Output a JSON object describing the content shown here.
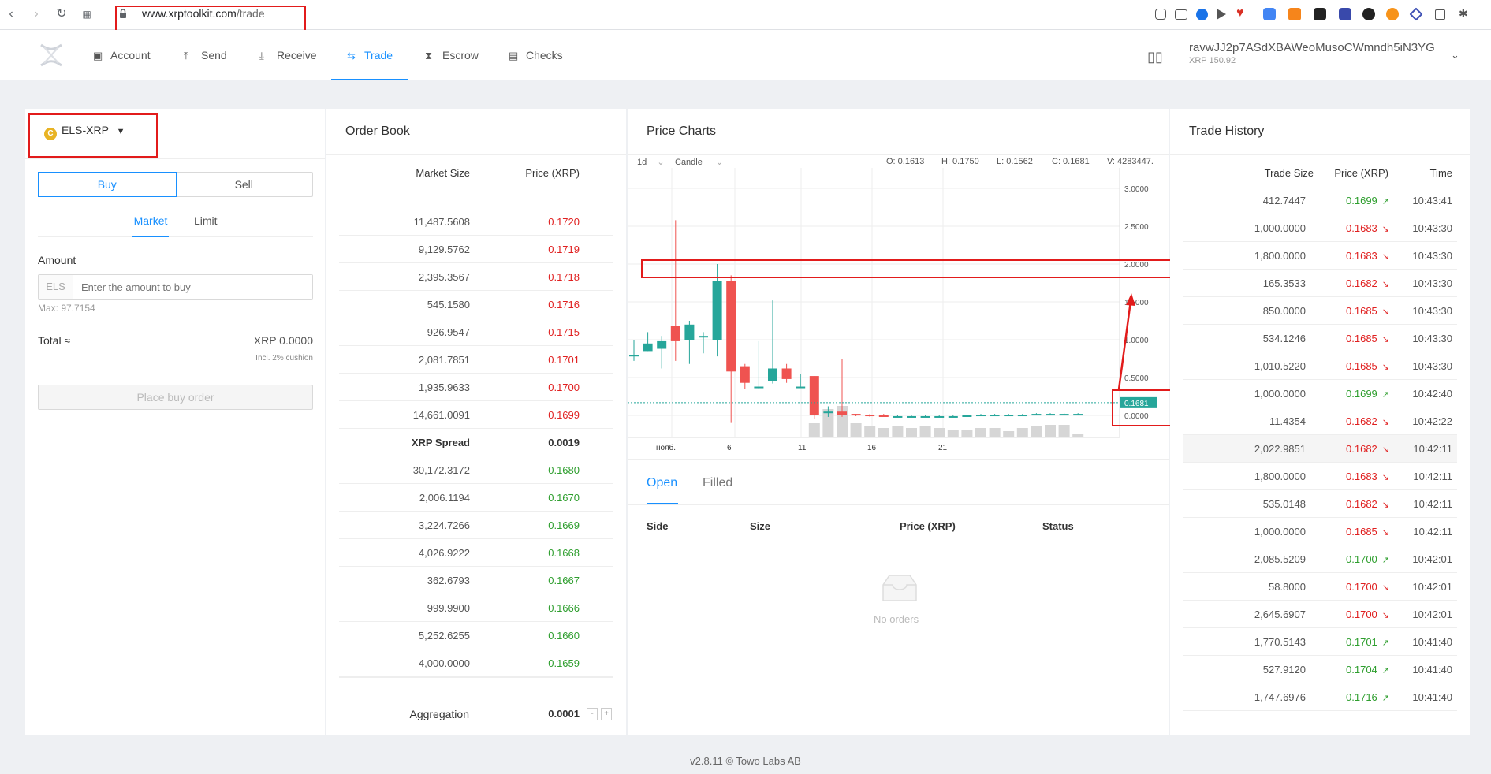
{
  "browser": {
    "url_host": "www.xrptoolkit.com",
    "url_path": "/trade"
  },
  "nav": {
    "items": [
      {
        "label": "Account",
        "icon": "wallet-icon"
      },
      {
        "label": "Send",
        "icon": "upload-icon"
      },
      {
        "label": "Receive",
        "icon": "download-icon"
      },
      {
        "label": "Trade",
        "icon": "swap-icon",
        "active": true
      },
      {
        "label": "Escrow",
        "icon": "hourglass-icon"
      },
      {
        "label": "Checks",
        "icon": "check-doc-icon"
      }
    ],
    "account_address": "ravwJJ2p7ASdXBAWeoMusoCWmndh5iN3YG",
    "account_balance": "XRP 150.92"
  },
  "trade": {
    "pair": "ELS-XRP",
    "pair_coin_glyph": "C",
    "buy_label": "Buy",
    "sell_label": "Sell",
    "market_label": "Market",
    "limit_label": "Limit",
    "amount_label": "Amount",
    "amount_unit": "ELS",
    "amount_placeholder": "Enter the amount to buy",
    "max_label": "Max: 97.7154",
    "total_label": "Total ≈",
    "total_value": "XRP 0.0000",
    "cushion_note": "Incl. 2% cushion",
    "place_order_label": "Place buy order"
  },
  "order_book": {
    "title": "Order Book",
    "col_size": "Market Size",
    "col_price": "Price (XRP)",
    "asks": [
      {
        "size": "11,487.5608",
        "price": "0.1720"
      },
      {
        "size": "9,129.5762",
        "price": "0.1719"
      },
      {
        "size": "2,395.3567",
        "price": "0.1718"
      },
      {
        "size": "545.1580",
        "price": "0.1716"
      },
      {
        "size": "926.9547",
        "price": "0.1715"
      },
      {
        "size": "2,081.7851",
        "price": "0.1701"
      },
      {
        "size": "1,935.9633",
        "price": "0.1700"
      },
      {
        "size": "14,661.0091",
        "price": "0.1699"
      }
    ],
    "spread_label": "XRP Spread",
    "spread_value": "0.0019",
    "bids": [
      {
        "size": "30,172.3172",
        "price": "0.1680"
      },
      {
        "size": "2,006.1194",
        "price": "0.1670"
      },
      {
        "size": "3,224.7266",
        "price": "0.1669"
      },
      {
        "size": "4,026.9222",
        "price": "0.1668"
      },
      {
        "size": "362.6793",
        "price": "0.1667"
      },
      {
        "size": "999.9900",
        "price": "0.1666"
      },
      {
        "size": "5,252.6255",
        "price": "0.1660"
      },
      {
        "size": "4,000.0000",
        "price": "0.1659"
      }
    ],
    "aggregation_label": "Aggregation",
    "aggregation_value": "0.0001"
  },
  "price_chart": {
    "title": "Price Charts",
    "interval": "1d",
    "style": "Candle",
    "ohlc": "O: 0.1613",
    "high": "H: 0.1750",
    "low": "L: 0.1562",
    "close": "C: 0.1681",
    "volume": "V: 4283447.",
    "current_price": "0.1681",
    "y_ticks": [
      "3.0000",
      "2.5000",
      "2.0000",
      "1.5000",
      "1.0000",
      "0.5000",
      "0.0000"
    ],
    "x_ticks": [
      "нояб.",
      "6",
      "11",
      "16",
      "21"
    ]
  },
  "chart_data": {
    "type": "bar",
    "title": "Price Charts",
    "ylim": [
      0,
      3.0
    ],
    "y_ticks": [
      3.0,
      2.5,
      2.0,
      1.5,
      1.0,
      0.5,
      0.0
    ],
    "x_ticks": [
      "нояб.",
      "6",
      "11",
      "16",
      "21"
    ],
    "candles": [
      {
        "o": 0.78,
        "h": 1.0,
        "l": 0.72,
        "c": 0.8
      },
      {
        "o": 0.85,
        "h": 1.1,
        "l": 0.85,
        "c": 0.95
      },
      {
        "o": 0.88,
        "h": 1.05,
        "l": 0.62,
        "c": 0.98
      },
      {
        "o": 1.18,
        "h": 2.58,
        "l": 0.72,
        "c": 0.98
      },
      {
        "o": 1.0,
        "h": 1.25,
        "l": 0.68,
        "c": 1.2
      },
      {
        "o": 1.05,
        "h": 1.1,
        "l": 0.82,
        "c": 1.05
      },
      {
        "o": 1.0,
        "h": 2.0,
        "l": 0.78,
        "c": 1.78
      },
      {
        "o": 1.78,
        "h": 1.85,
        "l": -0.1,
        "c": 0.58
      },
      {
        "o": 0.65,
        "h": 0.68,
        "l": 0.35,
        "c": 0.43
      },
      {
        "o": 0.38,
        "h": 0.98,
        "l": 0.35,
        "c": 0.38
      },
      {
        "o": 0.45,
        "h": 1.52,
        "l": 0.42,
        "c": 0.62
      },
      {
        "o": 0.62,
        "h": 0.68,
        "l": 0.43,
        "c": 0.48
      },
      {
        "o": 0.38,
        "h": 0.55,
        "l": 0.38,
        "c": 0.38
      },
      {
        "o": 0.52,
        "h": 0.52,
        "l": -0.05,
        "c": 0.01
      },
      {
        "o": 0.05,
        "h": 0.12,
        "l": -0.02,
        "c": 0.05
      },
      {
        "o": 0.05,
        "h": 0.75,
        "l": -0.02,
        "c": 0.0
      },
      {
        "o": 0.02,
        "h": 0.02,
        "l": -0.01,
        "c": 0.0
      },
      {
        "o": 0.01,
        "h": 0.02,
        "l": -0.02,
        "c": 0.0
      },
      {
        "o": 0.0,
        "h": 0.02,
        "l": -0.01,
        "c": -0.01
      },
      {
        "o": -0.01,
        "h": 0.01,
        "l": -0.02,
        "c": -0.01
      },
      {
        "o": -0.01,
        "h": 0.01,
        "l": -0.02,
        "c": -0.01
      },
      {
        "o": -0.01,
        "h": 0.01,
        "l": -0.02,
        "c": -0.01
      },
      {
        "o": -0.01,
        "h": 0.01,
        "l": -0.02,
        "c": -0.01
      },
      {
        "o": -0.01,
        "h": 0.01,
        "l": -0.02,
        "c": -0.01
      },
      {
        "o": -0.01,
        "h": 0.01,
        "l": -0.02,
        "c": 0.0
      },
      {
        "o": 0.0,
        "h": 0.02,
        "l": -0.01,
        "c": 0.01
      },
      {
        "o": 0.0,
        "h": 0.02,
        "l": -0.01,
        "c": 0.01
      },
      {
        "o": 0.0,
        "h": 0.02,
        "l": -0.01,
        "c": 0.01
      },
      {
        "o": 0.0,
        "h": 0.02,
        "l": -0.01,
        "c": 0.01
      },
      {
        "o": 0.01,
        "h": 0.03,
        "l": 0.0,
        "c": 0.02
      },
      {
        "o": 0.01,
        "h": 0.03,
        "l": 0.0,
        "c": 0.02
      },
      {
        "o": 0.01,
        "h": 0.03,
        "l": 0.0,
        "c": 0.02
      },
      {
        "o": 0.01,
        "h": 0.03,
        "l": 0.0,
        "c": 0.02
      }
    ],
    "volume_bars": [
      0,
      0,
      0,
      0,
      0,
      0,
      0,
      0,
      0,
      0,
      0,
      0,
      0,
      0.45,
      0.9,
      1.0,
      0.45,
      0.35,
      0.3,
      0.35,
      0.3,
      0.35,
      0.3,
      0.25,
      0.25,
      0.3,
      0.3,
      0.2,
      0.3,
      0.35,
      0.4,
      0.4,
      0.1
    ],
    "up_color": "#26a69a",
    "down_color": "#ef5350"
  },
  "orders": {
    "tab_open": "Open",
    "tab_filled": "Filled",
    "col_side": "Side",
    "col_size": "Size",
    "col_price": "Price (XRP)",
    "col_status": "Status",
    "empty_text": "No orders"
  },
  "trade_history": {
    "title": "Trade History",
    "col_size": "Trade Size",
    "col_price": "Price (XRP)",
    "col_time": "Time",
    "rows": [
      {
        "size": "412.7447",
        "price": "0.1699",
        "dir": "up",
        "time": "10:43:41"
      },
      {
        "size": "1,000.0000",
        "price": "0.1683",
        "dir": "down",
        "time": "10:43:30"
      },
      {
        "size": "1,800.0000",
        "price": "0.1683",
        "dir": "down",
        "time": "10:43:30"
      },
      {
        "size": "165.3533",
        "price": "0.1682",
        "dir": "down",
        "time": "10:43:30"
      },
      {
        "size": "850.0000",
        "price": "0.1685",
        "dir": "down",
        "time": "10:43:30"
      },
      {
        "size": "534.1246",
        "price": "0.1685",
        "dir": "down",
        "time": "10:43:30"
      },
      {
        "size": "1,010.5220",
        "price": "0.1685",
        "dir": "down",
        "time": "10:43:30"
      },
      {
        "size": "1,000.0000",
        "price": "0.1699",
        "dir": "up",
        "time": "10:42:40"
      },
      {
        "size": "11.4354",
        "price": "0.1682",
        "dir": "down",
        "time": "10:42:22"
      },
      {
        "size": "2,022.9851",
        "price": "0.1682",
        "dir": "down",
        "time": "10:42:11"
      },
      {
        "size": "1,800.0000",
        "price": "0.1683",
        "dir": "down",
        "time": "10:42:11"
      },
      {
        "size": "535.0148",
        "price": "0.1682",
        "dir": "down",
        "time": "10:42:11"
      },
      {
        "size": "1,000.0000",
        "price": "0.1685",
        "dir": "down",
        "time": "10:42:11"
      },
      {
        "size": "2,085.5209",
        "price": "0.1700",
        "dir": "up",
        "time": "10:42:01"
      },
      {
        "size": "58.8000",
        "price": "0.1700",
        "dir": "down",
        "time": "10:42:01"
      },
      {
        "size": "2,645.6907",
        "price": "0.1700",
        "dir": "down",
        "time": "10:42:01"
      },
      {
        "size": "1,770.5143",
        "price": "0.1701",
        "dir": "up",
        "time": "10:41:40"
      },
      {
        "size": "527.9120",
        "price": "0.1704",
        "dir": "up",
        "time": "10:41:40"
      },
      {
        "size": "1,747.6976",
        "price": "0.1716",
        "dir": "up",
        "time": "10:41:40"
      }
    ]
  },
  "footer": {
    "text": "v2.8.11 © Towo Labs AB"
  }
}
